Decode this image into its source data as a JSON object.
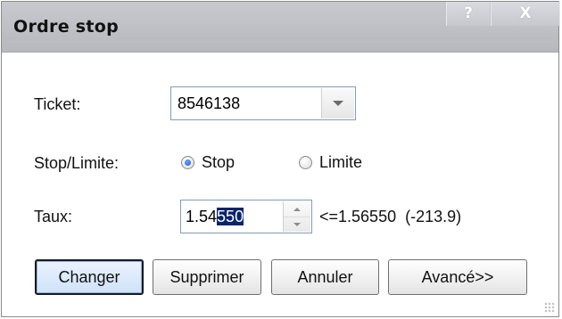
{
  "window": {
    "title": "Ordre stop",
    "help_label": "?",
    "close_label": "X"
  },
  "form": {
    "ticket": {
      "label": "Ticket:",
      "value": "8546138"
    },
    "stop_limite": {
      "label": "Stop/Limite:",
      "options": [
        {
          "label": "Stop",
          "selected": true
        },
        {
          "label": "Limite",
          "selected": false
        }
      ]
    },
    "taux": {
      "label": "Taux:",
      "value_unselected": "1.54",
      "value_selected": "550",
      "range_text": "<=1.56550  (-213.9)"
    }
  },
  "buttons": {
    "changer": "Changer",
    "supprimer": "Supprimer",
    "annuler": "Annuler",
    "avance": "Avancé>>"
  },
  "colors": {
    "selection_bg": "#0a246a",
    "radio_accent": "#1f57c9",
    "titlebar": "#bfc1c7"
  }
}
